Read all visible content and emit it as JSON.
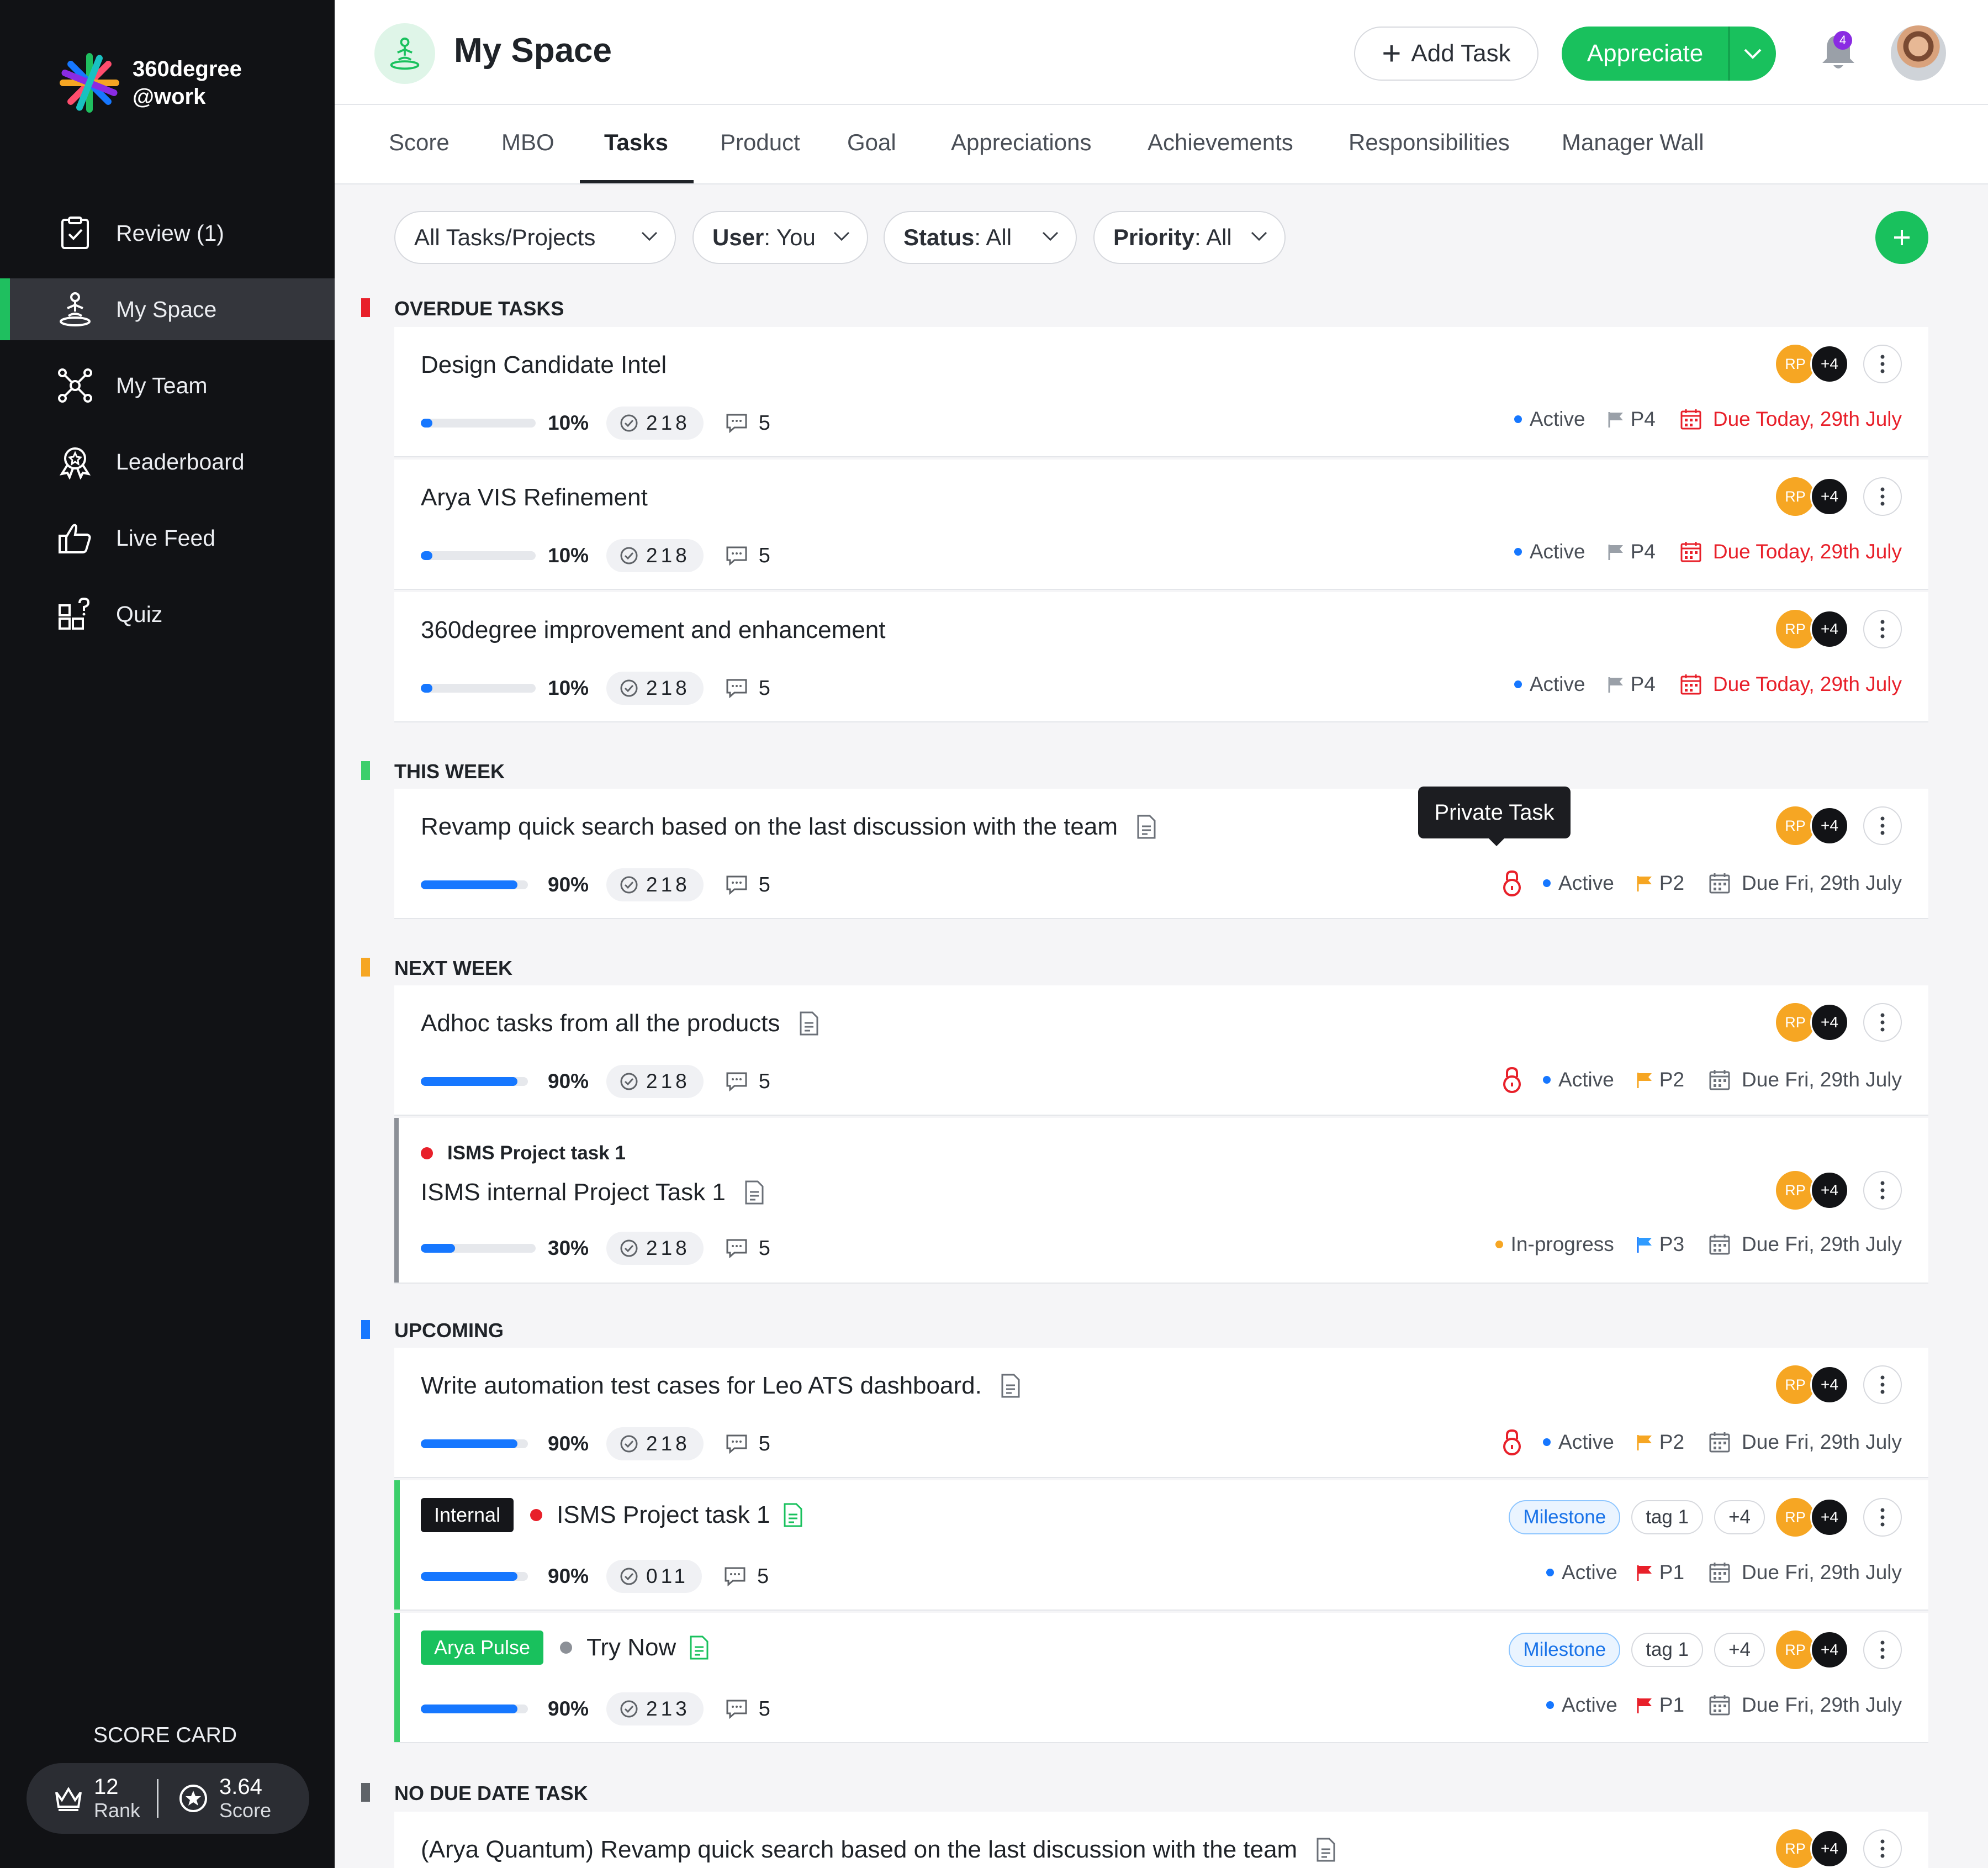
{
  "brand": {
    "line1": "360degree",
    "line2": "@work"
  },
  "sidebar": {
    "items": [
      {
        "label": "Review (1)",
        "icon": "clipboard-check-icon"
      },
      {
        "label": "My Space",
        "icon": "person-meditate-icon"
      },
      {
        "label": "My Team",
        "icon": "network-icon"
      },
      {
        "label": "Leaderboard",
        "icon": "award-icon"
      },
      {
        "label": "Live Feed",
        "icon": "thumbs-up-icon"
      },
      {
        "label": "Quiz",
        "icon": "quiz-blocks-icon"
      }
    ],
    "active": "My Space",
    "scorecard": {
      "title": "SCORE CARD",
      "rank_value": "12",
      "rank_label": "Rank",
      "score_value": "3.64",
      "score_label": "Score"
    }
  },
  "header": {
    "title": "My Space",
    "add_task": "Add Task",
    "appreciate": "Appreciate",
    "notification_count": "4"
  },
  "tabs": [
    "Score",
    "MBO",
    "Tasks",
    "Product",
    "Goal",
    "Appreciations",
    "Achievements",
    "Responsibilities",
    "Manager Wall"
  ],
  "active_tab": "Tasks",
  "filters": {
    "tasks": "All Tasks/Projects",
    "user_key": "User",
    "user_value": ": You",
    "status_key": "Status",
    "status_value": ": All",
    "priority_key": "Priority",
    "priority_value": ": All"
  },
  "colors": {
    "accent": "#19c15d",
    "overdue": "#e8202a",
    "this_week": "#3ccf6b",
    "next_week": "#f6a623",
    "upcoming": "#1677ff",
    "no_due": "#5f6368"
  },
  "tooltip": "Private Task",
  "sections": {
    "overdue": {
      "title": "OVERDUE TASKS",
      "tasks": [
        {
          "title": "Design Candidate Intel",
          "progress": 10,
          "pct": "10%",
          "count": "218",
          "comments": "5",
          "avatar": "RP",
          "more": "+4",
          "status": "Active",
          "priority": "P4",
          "due": "Due Today, 29th July"
        },
        {
          "title": "Arya VIS Refinement",
          "progress": 10,
          "pct": "10%",
          "count": "218",
          "comments": "5",
          "avatar": "RP",
          "more": "+4",
          "status": "Active",
          "priority": "P4",
          "due": "Due Today, 29th July"
        },
        {
          "title": "360degree improvement and enhancement",
          "progress": 10,
          "pct": "10%",
          "count": "218",
          "comments": "5",
          "avatar": "RP",
          "more": "+4",
          "status": "Active",
          "priority": "P4",
          "due": "Due Today, 29th July"
        }
      ]
    },
    "this_week": {
      "title": "THIS WEEK",
      "tasks": [
        {
          "title": "Revamp quick search based on the last discussion with the team",
          "progress": 90,
          "pct": "90%",
          "count": "218",
          "comments": "5",
          "avatar": "RP",
          "more": "+4",
          "status": "Active",
          "priority": "P2",
          "due": "Due Fri, 29th July"
        }
      ]
    },
    "next_week": {
      "title": "NEXT WEEK",
      "tasks": [
        {
          "title": "Adhoc tasks from all the products",
          "progress": 90,
          "pct": "90%",
          "count": "218",
          "comments": "5",
          "avatar": "RP",
          "more": "+4",
          "status": "Active",
          "priority": "P2",
          "due": "Due Fri, 29th July"
        },
        {
          "project": "ISMS Project task 1",
          "title": "ISMS internal Project Task 1",
          "progress": 30,
          "pct": "30%",
          "count": "218",
          "comments": "5",
          "avatar": "RP",
          "more": "+4",
          "status": "In-progress",
          "priority": "P3",
          "due": "Due Fri, 29th July"
        }
      ]
    },
    "upcoming": {
      "title": "UPCOMING",
      "tasks": [
        {
          "title": "Write automation test cases for Leo ATS dashboard.",
          "progress": 90,
          "pct": "90%",
          "count": "218",
          "comments": "5",
          "avatar": "RP",
          "more": "+4",
          "status": "Active",
          "priority": "P2",
          "due": "Due Fri, 29th July"
        },
        {
          "badge": "Internal",
          "title": "ISMS Project task 1",
          "progress": 90,
          "pct": "90%",
          "count": "011",
          "comments": "5",
          "tags": [
            "Milestone",
            "tag 1",
            "+4"
          ],
          "avatar": "RP",
          "more": "+4",
          "status": "Active",
          "priority": "P1",
          "due": "Due Fri, 29th July"
        },
        {
          "badge": "Arya Pulse",
          "title": "Try Now",
          "progress": 90,
          "pct": "90%",
          "count": "213",
          "comments": "5",
          "tags": [
            "Milestone",
            "tag 1",
            "+4"
          ],
          "avatar": "RP",
          "more": "+4",
          "status": "Active",
          "priority": "P1",
          "due": "Due Fri, 29th July"
        }
      ]
    },
    "no_due": {
      "title": "NO DUE DATE TASK",
      "tasks": [
        {
          "title": "(Arya Quantum) Revamp quick search based on the last discussion with the team",
          "avatar": "RP",
          "more": "+4"
        }
      ]
    }
  }
}
